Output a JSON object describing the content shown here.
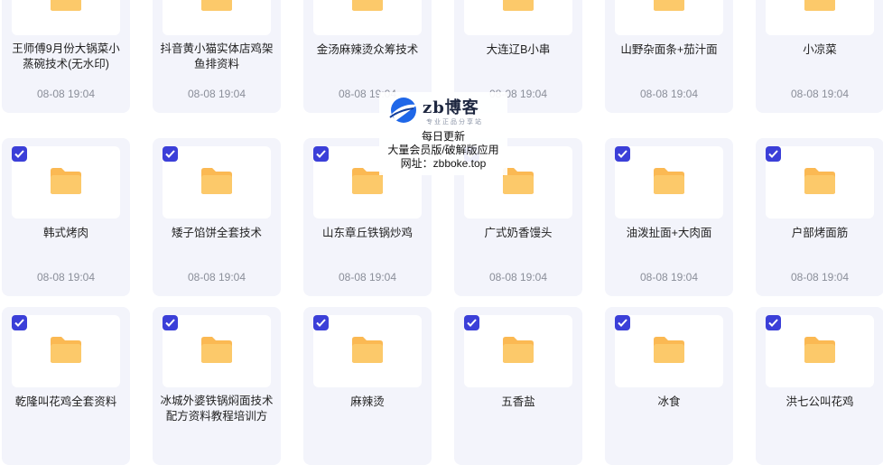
{
  "colors": {
    "card_bg": "#f3f4fb",
    "checkbox": "#3b3fd8",
    "folder": "#fcc96a",
    "date": "#8a8e99"
  },
  "folder_icon": "folder-icon",
  "rows": [
    [
      {
        "name": "王师傅9月份大锅菜小蒸碗技术(无水印)",
        "date": "08-08 19:04",
        "checked": false
      },
      {
        "name": "抖音黄小猫实体店鸡架鱼排资料",
        "date": "08-08 19:04",
        "checked": false
      },
      {
        "name": "金汤麻辣烫众筹技术",
        "date": "08-08 19:04",
        "checked": false
      },
      {
        "name": "大连辽B小串",
        "date": "08-08 19:04",
        "checked": false
      },
      {
        "name": "山野杂面条+茄汁面",
        "date": "08-08 19:04",
        "checked": false
      },
      {
        "name": "小凉菜",
        "date": "08-08 19:04",
        "checked": false
      }
    ],
    [
      {
        "name": "韩式烤肉",
        "date": "08-08 19:04",
        "checked": true
      },
      {
        "name": "矮子馅饼全套技术",
        "date": "08-08 19:04",
        "checked": true
      },
      {
        "name": "山东章丘铁锅炒鸡",
        "date": "08-08 19:04",
        "checked": true
      },
      {
        "name": "广式奶香馒头",
        "date": "08-08 19:04",
        "checked": true
      },
      {
        "name": "油泼扯面+大肉面",
        "date": "08-08 19:04",
        "checked": true
      },
      {
        "name": "户部烤面筋",
        "date": "08-08 19:04",
        "checked": true
      }
    ],
    [
      {
        "name": "乾隆叫花鸡全套资料",
        "date": "",
        "checked": true
      },
      {
        "name": "冰城外婆铁锅焖面技术配方资料教程培训方",
        "date": "",
        "checked": true
      },
      {
        "name": "麻辣烫",
        "date": "",
        "checked": true
      },
      {
        "name": "五香盐",
        "date": "",
        "checked": true
      },
      {
        "name": "冰食",
        "date": "",
        "checked": true
      },
      {
        "name": "洪七公叫花鸡",
        "date": "",
        "checked": true
      }
    ]
  ],
  "watermark": {
    "title": "zb博客",
    "slogan": "专业正品分享站",
    "line1": "每日更新",
    "line2": "大量会员版/破解版应用",
    "line3": "网址：zbboke.top"
  }
}
